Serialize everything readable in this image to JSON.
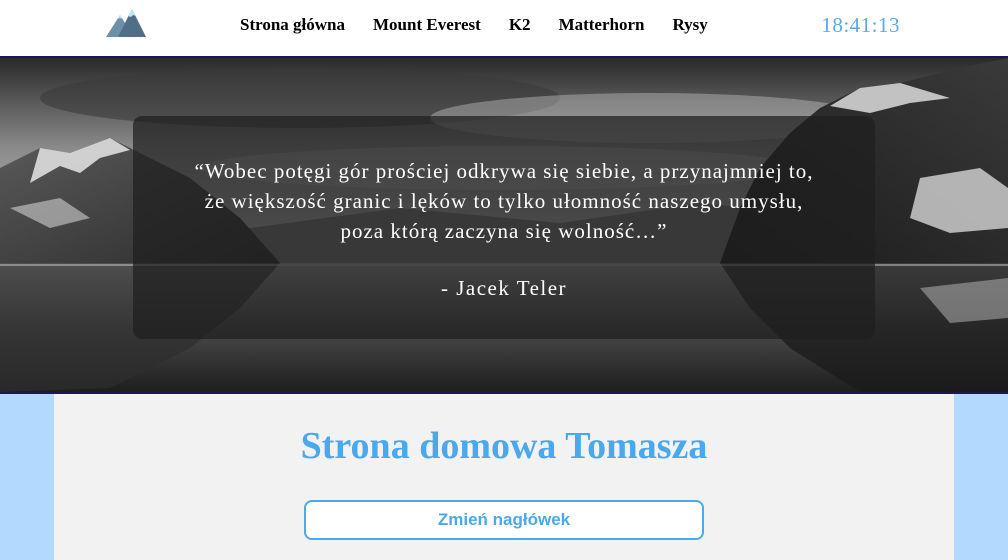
{
  "header": {
    "logo_icon": "mountain-logo-icon",
    "nav": [
      {
        "label": "Strona główna"
      },
      {
        "label": "Mount Everest"
      },
      {
        "label": "K2"
      },
      {
        "label": "Matterhorn"
      },
      {
        "label": "Rysy"
      }
    ],
    "clock": "18:41:13"
  },
  "hero": {
    "quote": "“Wobec potęgi gór prościej odkrywa się siebie, a przynajmniej to,\nże większość granic i lęków to tylko ułomność naszego umysłu,\npoza którą zaczyna się wolność…”",
    "author": "- Jacek Teler"
  },
  "main": {
    "title": "Strona domowa Tomasza",
    "button_label": "Zmień nagłówek"
  },
  "colors": {
    "accent": "#4aa8ec",
    "clock": "#5aa9e6",
    "page_background": "#b3d9ff",
    "content_background": "#f2f2f2",
    "header_border": "#1a1a4d"
  }
}
